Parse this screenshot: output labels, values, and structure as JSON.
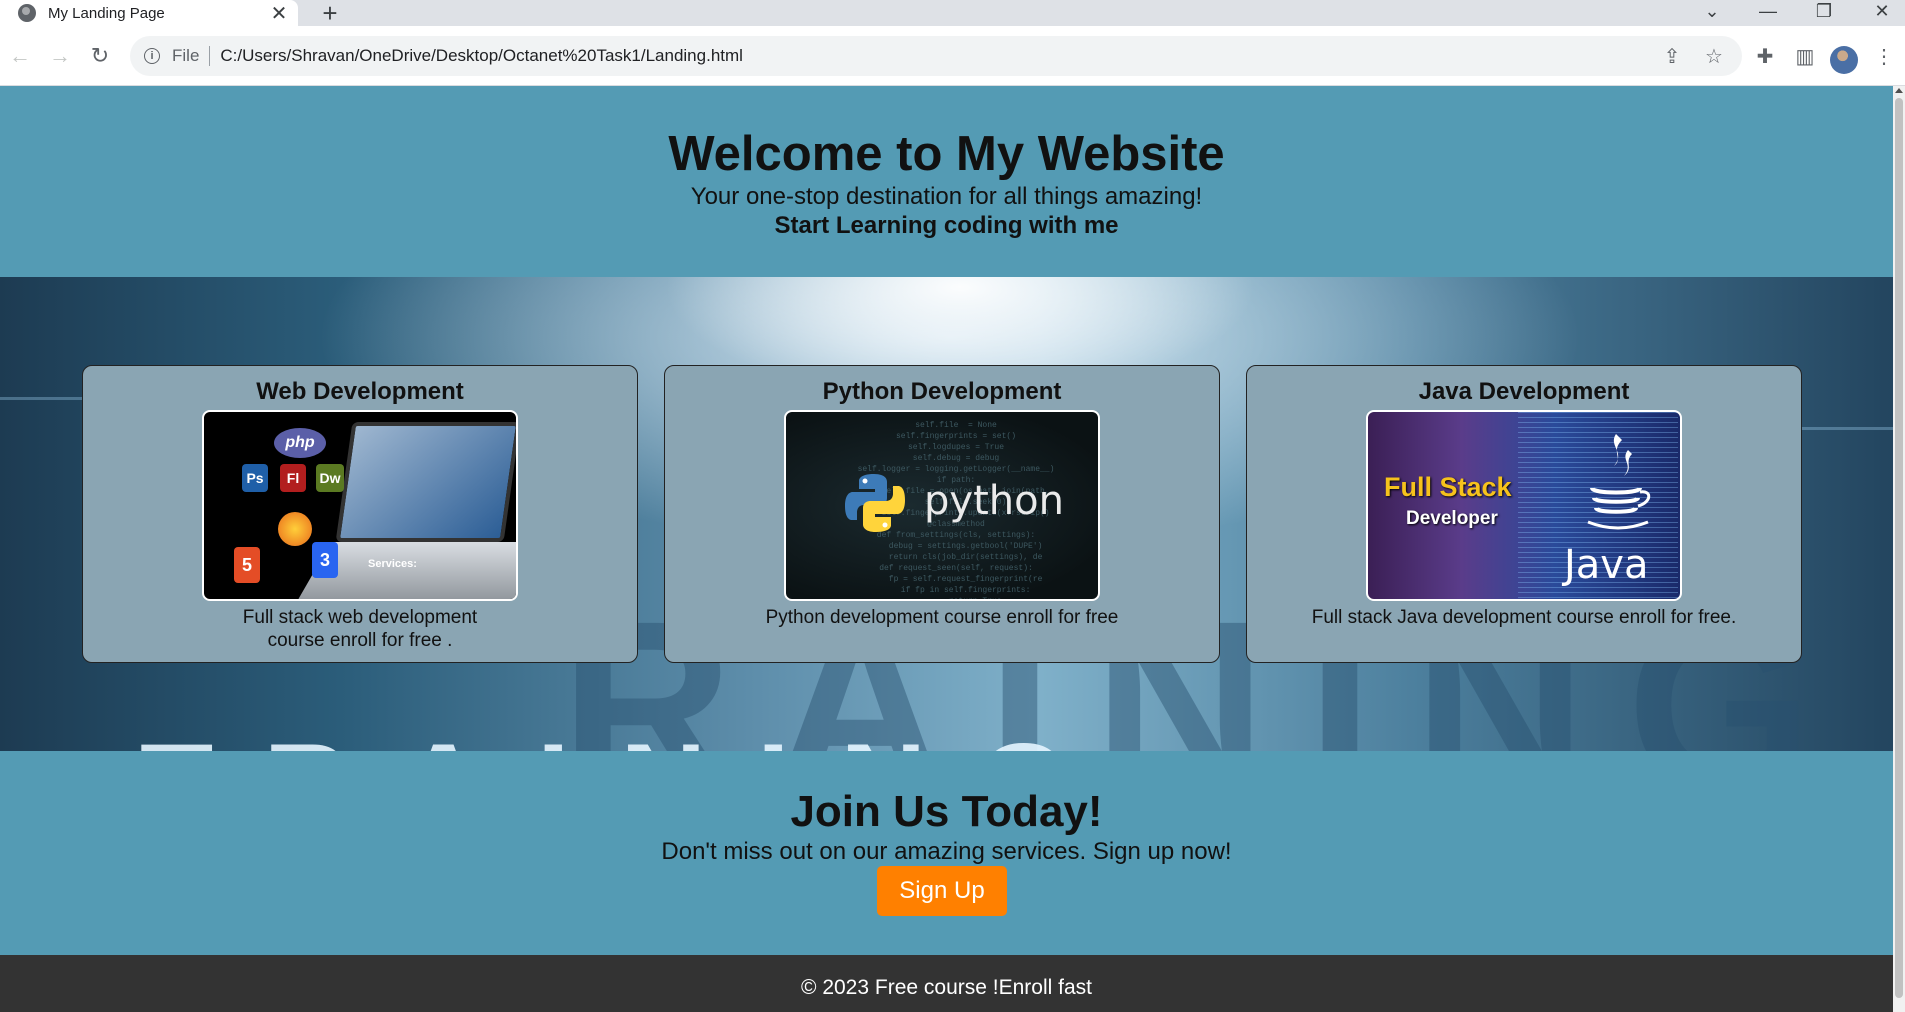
{
  "browser": {
    "tab_title": "My Landing Page",
    "new_tab_symbol": "+",
    "file_label": "File",
    "url": "C:/Users/Shravan/OneDrive/Desktop/Octanet%20Task1/Landing.html"
  },
  "hero": {
    "title": "Welcome to My Website",
    "tagline": "Your one-stop destination for all things amazing!",
    "subtitle": "Start Learning coding with me"
  },
  "services": [
    {
      "title": "Web Development",
      "description": "Full stack web development course enroll for free ."
    },
    {
      "title": "Python Development",
      "description": "Python development course enroll for free"
    },
    {
      "title": "Java Development",
      "description": "Full stack Java development course enroll for free."
    }
  ],
  "images": {
    "web": {
      "badges": [
        "php",
        "Ps",
        "Fl",
        "Dw",
        "5",
        "3"
      ],
      "caption": "Services:"
    },
    "python": {
      "word": "python"
    },
    "java": {
      "headline": "Full Stack",
      "sub": "Developer",
      "word": "Java"
    }
  },
  "join": {
    "title": "Join Us Today!",
    "text": "Don't miss out on our amazing services. Sign up now!",
    "button": "Sign Up"
  },
  "footer": {
    "text": "© 2023 Free course !Enroll fast"
  },
  "colors": {
    "section_bg": "#549bb4",
    "card_bg": "#8aa5b3",
    "button": "#ff8000",
    "footer_bg": "#333333"
  }
}
